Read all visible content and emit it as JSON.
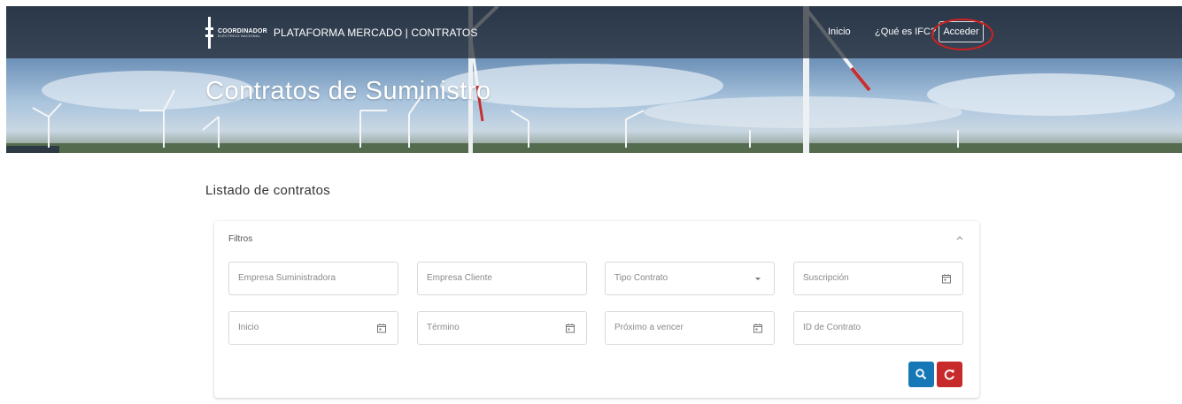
{
  "header": {
    "org_line1": "COORDINADOR",
    "org_line2": "ELÉCTRICO NACIONAL",
    "platform_title": "PLATAFORMA MERCADO | CONTRATOS",
    "nav": {
      "inicio": "Inicio",
      "que_es": "¿Qué es IFC?",
      "acceder": "Acceder"
    }
  },
  "hero": {
    "title": "Contratos de Suministro"
  },
  "main": {
    "section_title": "Listado de contratos",
    "filters": {
      "title": "Filtros",
      "fields": {
        "empresa_suministradora": "Empresa Suministradora",
        "empresa_cliente": "Empresa Cliente",
        "tipo_contrato": "Tipo Contrato",
        "suscripcion": "Suscripción",
        "inicio": "Inicio",
        "termino": "Término",
        "proximo_a_vencer": "Próximo a vencer",
        "id_contrato": "ID de Contrato"
      }
    }
  },
  "colors": {
    "search_button": "#1677b6",
    "reset_button": "#c62a2a",
    "annotation": "#d22020"
  },
  "icons": [
    "logo-icon",
    "calendar-icon",
    "chevron-down-icon",
    "chevron-up-icon",
    "search-icon",
    "refresh-icon"
  ]
}
